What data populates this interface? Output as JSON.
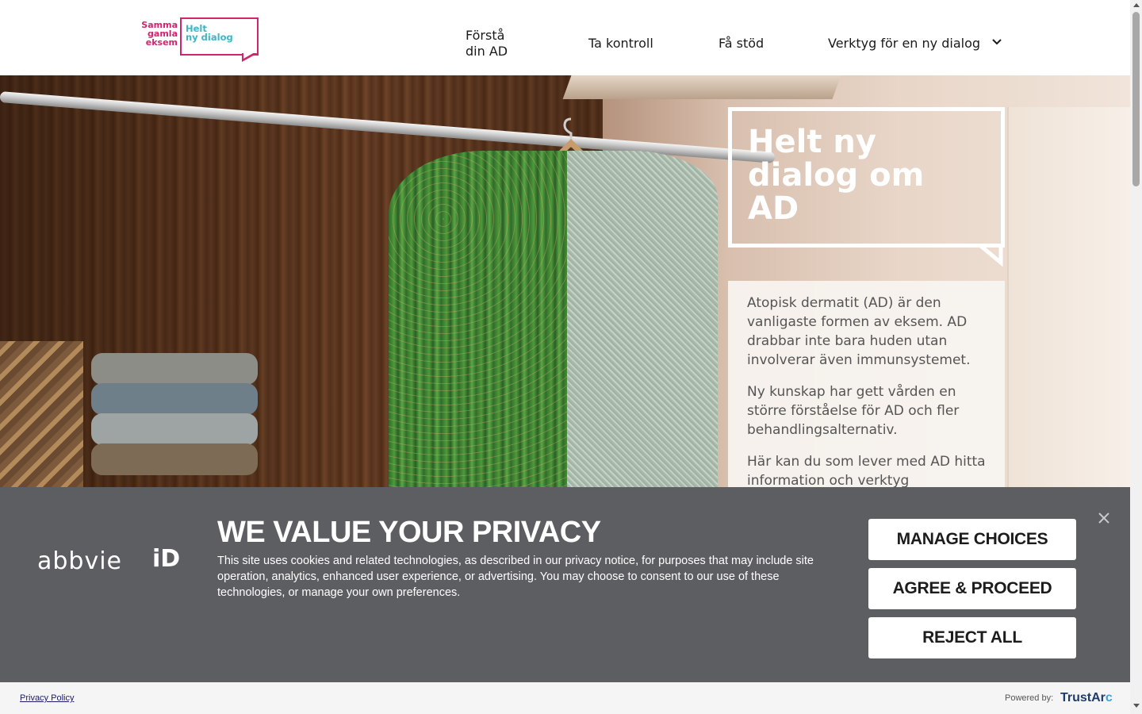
{
  "header": {
    "logo": {
      "left_text": "Samma\ngamla\neksem",
      "right_text": "Helt\nny dialog",
      "colors": {
        "pink": "#d1246f",
        "teal": "#3fb5c5"
      }
    },
    "nav": [
      {
        "label": "Förstå\ndin AD"
      },
      {
        "label": "Ta kontroll"
      },
      {
        "label": "Få stöd"
      },
      {
        "label": "Verktyg för en ny dialog",
        "icon": "chevron-down-icon"
      }
    ]
  },
  "hero": {
    "title": "Helt ny dialog om AD",
    "paragraphs": [
      "Atopisk dermatit (AD) är den vanligaste formen av eksem. AD drabbar inte bara huden utan involverar även immunsystemet.",
      "Ny kunskap har gett vården en större förståelse för AD och fler behandlingsalternativ.",
      "Här kan du som lever med AD hitta information och verktyg"
    ]
  },
  "cookie_banner": {
    "brand": "abbvie",
    "brand_suffix": "iD",
    "title": "WE VALUE YOUR PRIVACY",
    "body": "This site uses cookies and related technologies, as described in our privacy notice, for purposes that may include site operation, analytics, enhanced user experience, or advertising. You may choose to consent to our use of these technologies, or manage your own preferences.",
    "buttons": {
      "manage": "MANAGE CHOICES",
      "agree": "AGREE & PROCEED",
      "reject": "REJECT ALL"
    },
    "close_icon": "close-icon",
    "background": "#5d5e62"
  },
  "footer": {
    "privacy_link": "Privacy Policy",
    "powered_by": "Powered by:",
    "trustarc_a": "TrustAr",
    "trustarc_b": "c"
  }
}
